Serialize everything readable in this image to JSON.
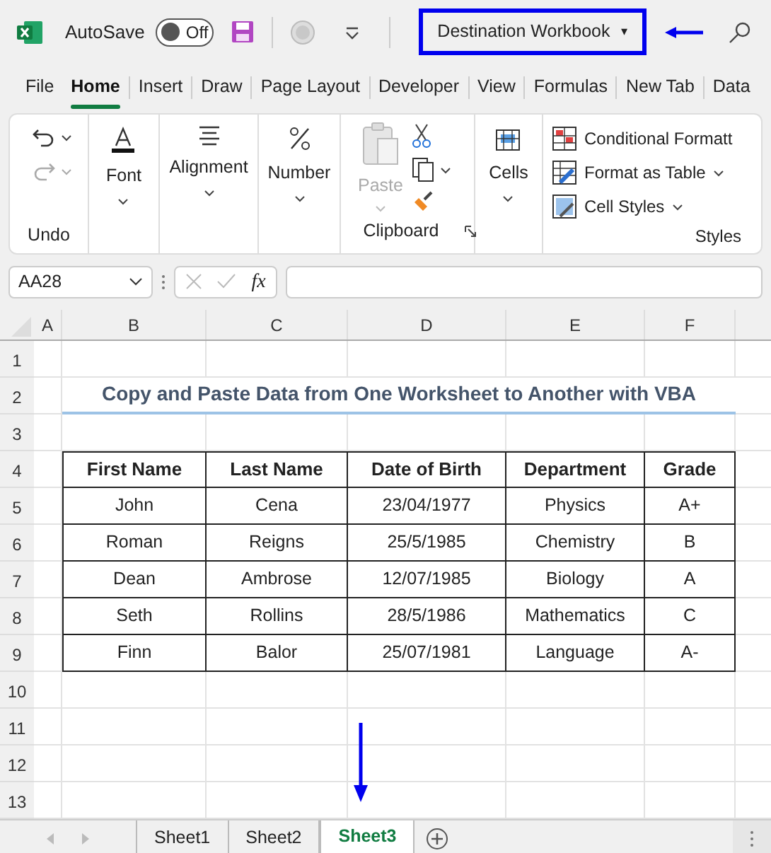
{
  "title_bar": {
    "autosave_label": "AutoSave",
    "autosave_toggle": {
      "label": "Off",
      "on": false
    },
    "workbook_name": "Destination Workbook",
    "workbook_caret": "▾",
    "highlighted": true
  },
  "ribbon_tabs": [
    {
      "label": "File",
      "selected": false
    },
    {
      "label": "Home",
      "selected": true
    },
    {
      "label": "Insert",
      "selected": false
    },
    {
      "label": "Draw",
      "selected": false
    },
    {
      "label": "Page Layout",
      "selected": false
    },
    {
      "label": "Developer",
      "selected": false
    },
    {
      "label": "View",
      "selected": false
    },
    {
      "label": "Formulas",
      "selected": false
    },
    {
      "label": "New Tab",
      "selected": false
    },
    {
      "label": "Data",
      "selected": false
    }
  ],
  "ribbon": {
    "undo_group": "Undo",
    "font": "Font",
    "alignment": "Alignment",
    "number": "Number",
    "paste": "Paste",
    "clipboard_group": "Clipboard",
    "cells": "Cells",
    "styles_items": [
      "Conditional Formatt",
      "Format as Table",
      "Cell Styles"
    ],
    "styles_group": "Styles"
  },
  "formula_bar": {
    "name_box": "AA28",
    "fx": "fx"
  },
  "columns": [
    "A",
    "B",
    "C",
    "D",
    "E",
    "F"
  ],
  "row_numbers": [
    "1",
    "2",
    "3",
    "4",
    "5",
    "6",
    "7",
    "8",
    "9",
    "10",
    "11",
    "12",
    "13"
  ],
  "sheet_title": "Copy and Paste Data from One Worksheet to Another with VBA",
  "table": {
    "columns": [
      "First Name",
      "Last Name",
      "Date of Birth",
      "Department",
      "Grade"
    ],
    "rows": [
      [
        "John",
        "Cena",
        "23/04/1977",
        "Physics",
        "A+"
      ],
      [
        "Roman",
        "Reigns",
        "25/5/1985",
        "Chemistry",
        "B"
      ],
      [
        "Dean",
        "Ambrose",
        "12/07/1985",
        "Biology",
        "A"
      ],
      [
        "Seth",
        "Rollins",
        "28/5/1986",
        "Mathematics",
        "C"
      ],
      [
        "Finn",
        "Balor",
        "25/07/1981",
        "Language",
        "A-"
      ]
    ]
  },
  "sheet_tabs": [
    {
      "label": "Sheet1",
      "selected": false
    },
    {
      "label": "Sheet2",
      "selected": false
    },
    {
      "label": "Sheet3",
      "selected": true
    }
  ]
}
